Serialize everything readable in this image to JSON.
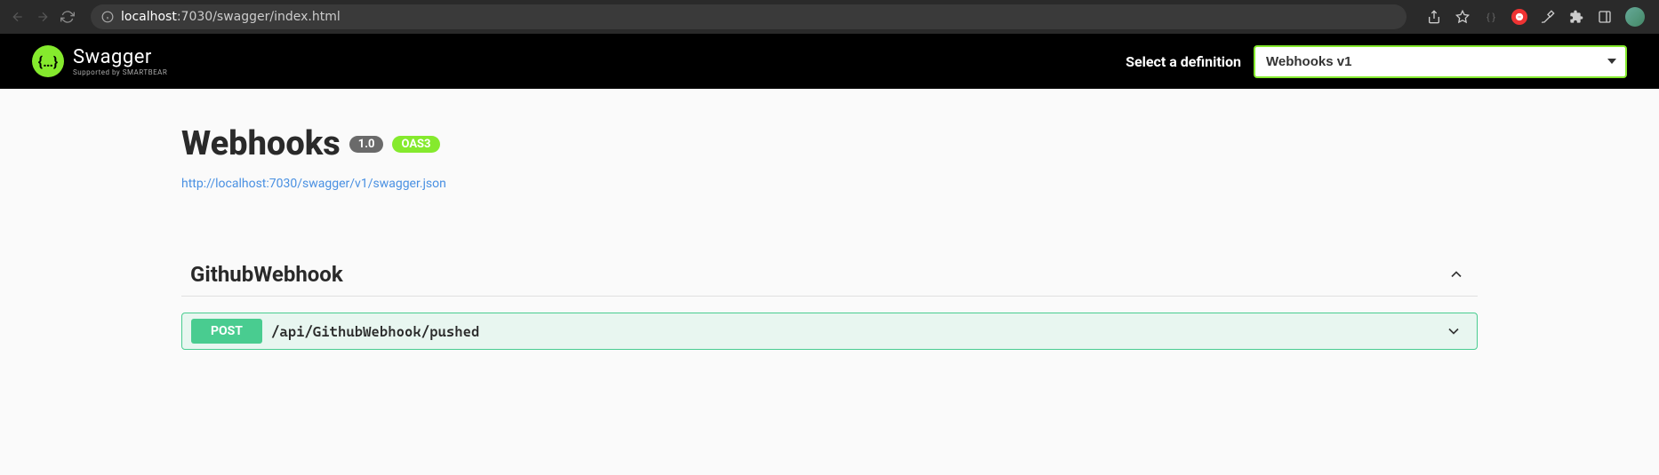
{
  "browser": {
    "url_host": "localhost",
    "url_port": ":7030",
    "url_path": "/swagger/index.html"
  },
  "topbar": {
    "brand_name": "Swagger",
    "brand_supported": "Supported by SMARTBEAR",
    "definition_label": "Select a definition",
    "definition_selected": "Webhooks v1"
  },
  "info": {
    "title": "Webhooks",
    "version": "1.0",
    "oas_badge": "OAS3",
    "spec_url": "http://localhost:7030/swagger/v1/swagger.json"
  },
  "tag": {
    "name": "GithubWebhook"
  },
  "operation": {
    "method": "POST",
    "path": "/api/GithubWebhook/pushed"
  }
}
